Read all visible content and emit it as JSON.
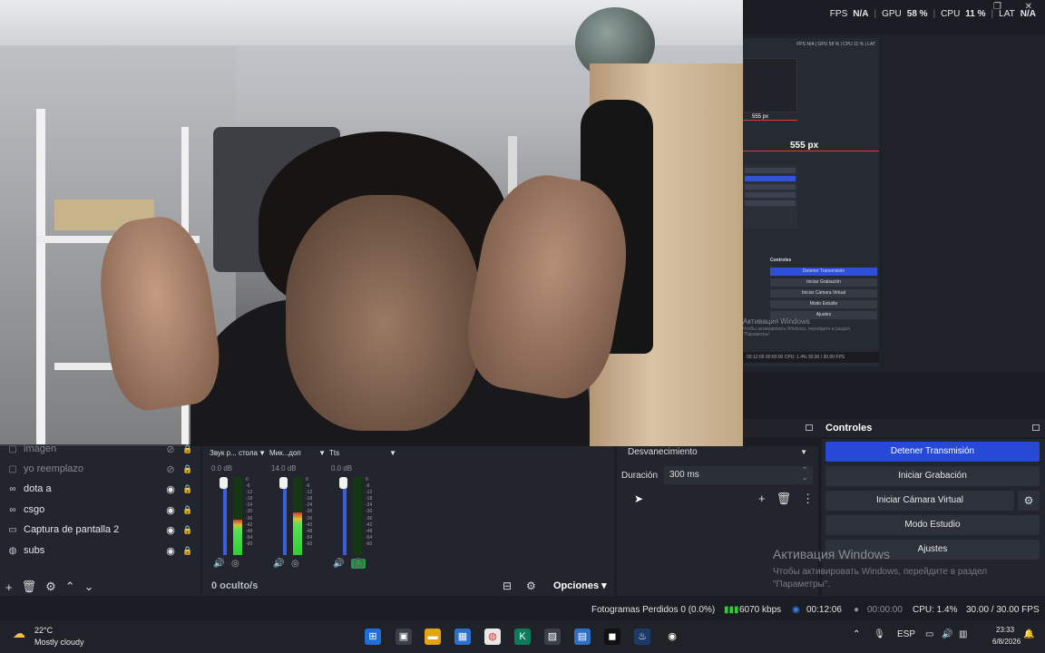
{
  "top_stats": {
    "fps_label": "FPS",
    "fps_value": "N/A",
    "gpu_label": "GPU",
    "gpu_value": "58 %",
    "cpu_label": "CPU",
    "cpu_value": "11 %",
    "lat_label": "LAT",
    "lat_value": "N/A"
  },
  "preview": {
    "size_label": "555 px",
    "mini_size_label": "555 px",
    "mini_controls": [
      "Detener Transmisión",
      "Iniciar Grabación",
      "Iniciar Cámara Virtual",
      "Modo Estudio",
      "Ajustes"
    ],
    "mini_controls_title": "Controles",
    "mini_activation": "Активация Windows",
    "mini_activation_sub": "Чтобы активировать Windows, перейдите в раздел \"Параметры\".",
    "mini_footer": "00:12:06   00:00:00   CPU: 1.4%   30.00 / 30.00 FPS"
  },
  "sources": {
    "items": [
      {
        "icon": "▢",
        "label": "imagen",
        "dim": true
      },
      {
        "icon": "▢",
        "label": "yo reemplazo",
        "dim": true
      },
      {
        "icon": "∞",
        "label": "dota a",
        "dim": false
      },
      {
        "icon": "∞",
        "label": "csgo",
        "dim": false
      },
      {
        "icon": "▭",
        "label": "Captura de pantalla 2",
        "dim": false
      },
      {
        "icon": "◍",
        "label": "subs",
        "dim": false
      }
    ]
  },
  "mixer": {
    "channels": [
      {
        "name": "Звук р... стола",
        "db": "0.0 dB",
        "level": 0.45,
        "monitor_on": false
      },
      {
        "name": "Мик...доп",
        "db": "14.0 dB",
        "level": 0.55,
        "monitor_on": false
      },
      {
        "name": "Tts",
        "db": "0.0 dB",
        "level": 0.0,
        "monitor_on": true
      }
    ],
    "scale": [
      "0",
      "-6",
      "-12",
      "-18",
      "-24",
      "-30",
      "-36",
      "-42",
      "-48",
      "-54",
      "-60"
    ],
    "hidden_label": "0 oculto/s",
    "options_label": "Opciones"
  },
  "transitions": {
    "selected": "Desvanecimiento",
    "duration_label": "Duración",
    "duration_value": "300 ms"
  },
  "controls": {
    "title": "Controles",
    "stop_stream": "Detener Transmisión",
    "start_record": "Iniciar Grabación",
    "virtual_cam": "Iniciar Cámara Virtual",
    "studio_mode": "Modo Estudio",
    "settings": "Ajustes"
  },
  "activation": {
    "title": "Активация Windows",
    "subtitle": "Чтобы активировать Windows, перейдите в раздел \"Параметры\"."
  },
  "status": {
    "dropped": "Fotogramas Perdidos 0 (0.0%)",
    "bitrate": "6070 kbps",
    "stream_time": "00:12:06",
    "rec_time": "00:00:00",
    "cpu": "CPU: 1.4%",
    "fps": "30.00 / 30.00 FPS"
  },
  "taskbar": {
    "temp": "22°C",
    "condition": "Mostly cloudy",
    "lang": "ESP",
    "time": "23:33",
    "date": "6/8/2026"
  },
  "colors": {
    "accent": "#2649d6",
    "meter_green": "#2fd12f",
    "monitor_on": "#1f9a45",
    "guide_red": "#e03a3a"
  }
}
